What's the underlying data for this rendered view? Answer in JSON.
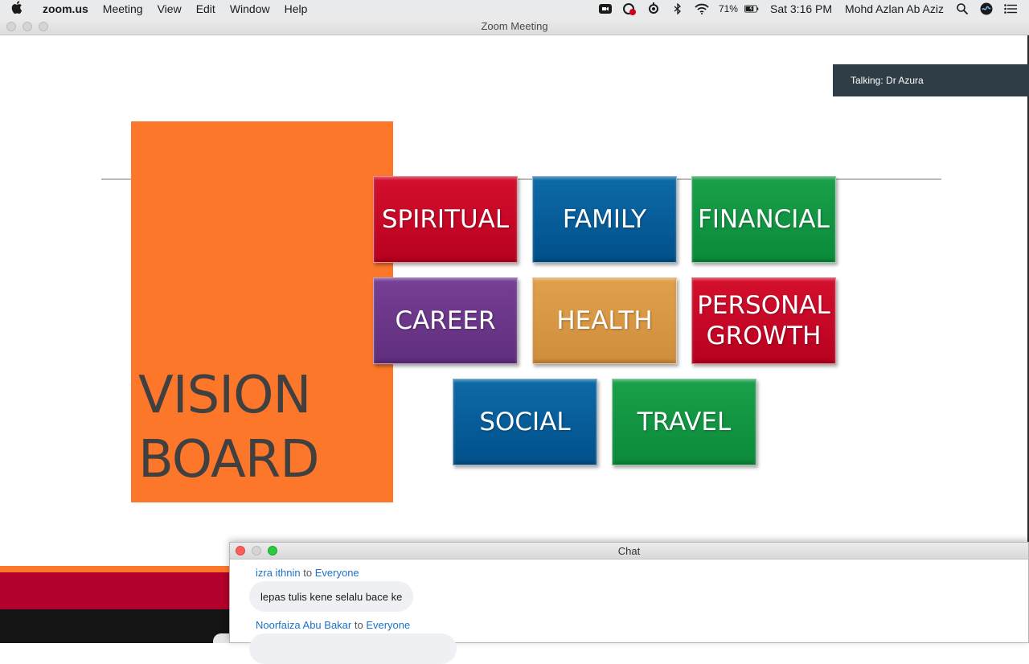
{
  "menubar": {
    "app_name": "zoom.us",
    "menus": [
      "Meeting",
      "View",
      "Edit",
      "Window",
      "Help"
    ],
    "battery": "71%",
    "clock": "Sat 3:16 PM",
    "user": "Mohd Azlan Ab Aziz"
  },
  "window": {
    "title": "Zoom Meeting",
    "talking_indicator": "Talking: Dr Azura"
  },
  "slide": {
    "title_line1": "VISION",
    "title_line2": "BOARD",
    "tiles": [
      {
        "label": "SPIRITUAL",
        "color": "#c8072a"
      },
      {
        "label": "FAMILY",
        "color": "#005b97"
      },
      {
        "label": "FINANCIAL",
        "color": "#0f9442"
      },
      {
        "label": "CAREER",
        "color": "#6a3688"
      },
      {
        "label": "HEALTH",
        "color": "#d99744"
      },
      {
        "label_line1": "PERSONAL",
        "label_line2": "GROWTH",
        "color": "#c8072a"
      },
      {
        "label": "SOCIAL",
        "color": "#005b97"
      },
      {
        "label": "TRAVEL",
        "color": "#0f9442"
      }
    ]
  },
  "chat": {
    "title": "Chat",
    "messages": [
      {
        "sender": "izra ithnin",
        "to_word": "to",
        "recipient": "Everyone",
        "text": "lepas tulis kene selalu bace ke"
      },
      {
        "sender": "Noorfaiza Abu Bakar",
        "to_word": "to",
        "recipient": "Everyone",
        "text": ""
      }
    ]
  },
  "colors": {
    "accent_orange": "#fd772b",
    "title_text": "#404040",
    "chat_name": "#1c73c7"
  }
}
